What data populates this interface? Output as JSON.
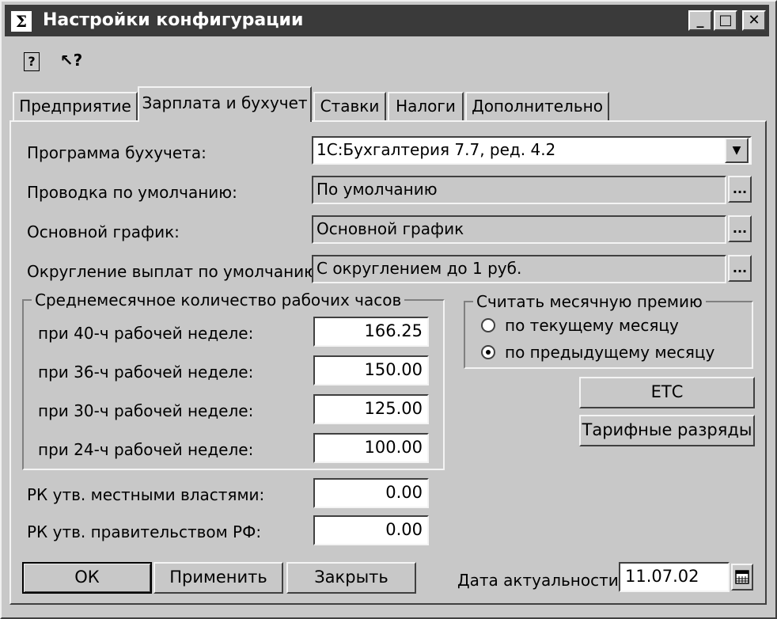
{
  "window": {
    "app_icon": "Σ",
    "title": "Настройки конфигурации",
    "controls": {
      "minimize": "_",
      "maximize": "□",
      "close": "✕"
    }
  },
  "toolbar": {
    "help_icon": "?",
    "pointer_help_icon": "↖?"
  },
  "tabs": [
    {
      "label": "Предприятие",
      "active": false
    },
    {
      "label": "Зарплата и бухучет",
      "active": true
    },
    {
      "label": "Ставки",
      "active": false
    },
    {
      "label": "Налоги",
      "active": false
    },
    {
      "label": "Дополнительно",
      "active": false
    }
  ],
  "form": {
    "accounting_program": {
      "label": "Программа бухучета:",
      "value": "1С:Бухгалтерия 7.7, ред. 4.2"
    },
    "default_posting": {
      "label": "Проводка по умолчанию:",
      "value": "По умолчанию"
    },
    "main_schedule": {
      "label": "Основной график:",
      "value": "Основной график"
    },
    "rounding": {
      "label": "Округление выплат по умолчанию:",
      "value": "С округлением до 1 руб."
    },
    "ellipsis": "..."
  },
  "hours_group": {
    "legend": "Среднемесячное количество рабочих часов",
    "rows": [
      {
        "label": "при 40-ч рабочей неделе:",
        "value": "166.25"
      },
      {
        "label": "при 36-ч рабочей неделе:",
        "value": "150.00"
      },
      {
        "label": "при 30-ч рабочей неделе:",
        "value": "125.00"
      },
      {
        "label": "при 24-ч рабочей неделе:",
        "value": "100.00"
      }
    ]
  },
  "bonus_group": {
    "legend": "Считать месячную премию",
    "options": [
      {
        "label": "по текущему месяцу",
        "selected": false
      },
      {
        "label": "по предыдущему месяцу",
        "selected": true
      }
    ]
  },
  "side_buttons": {
    "ets": "ЕТС",
    "tariff": "Тарифные разряды"
  },
  "coefficients": {
    "local": {
      "label": "РК утв. местными властями:",
      "value": "0.00"
    },
    "government": {
      "label": "РК утв. правительством РФ:",
      "value": "0.00"
    }
  },
  "footer": {
    "ok": "ОК",
    "apply": "Применить",
    "close": "Закрыть",
    "date_label": "Дата актуальности",
    "date_value": "11.07.02"
  }
}
